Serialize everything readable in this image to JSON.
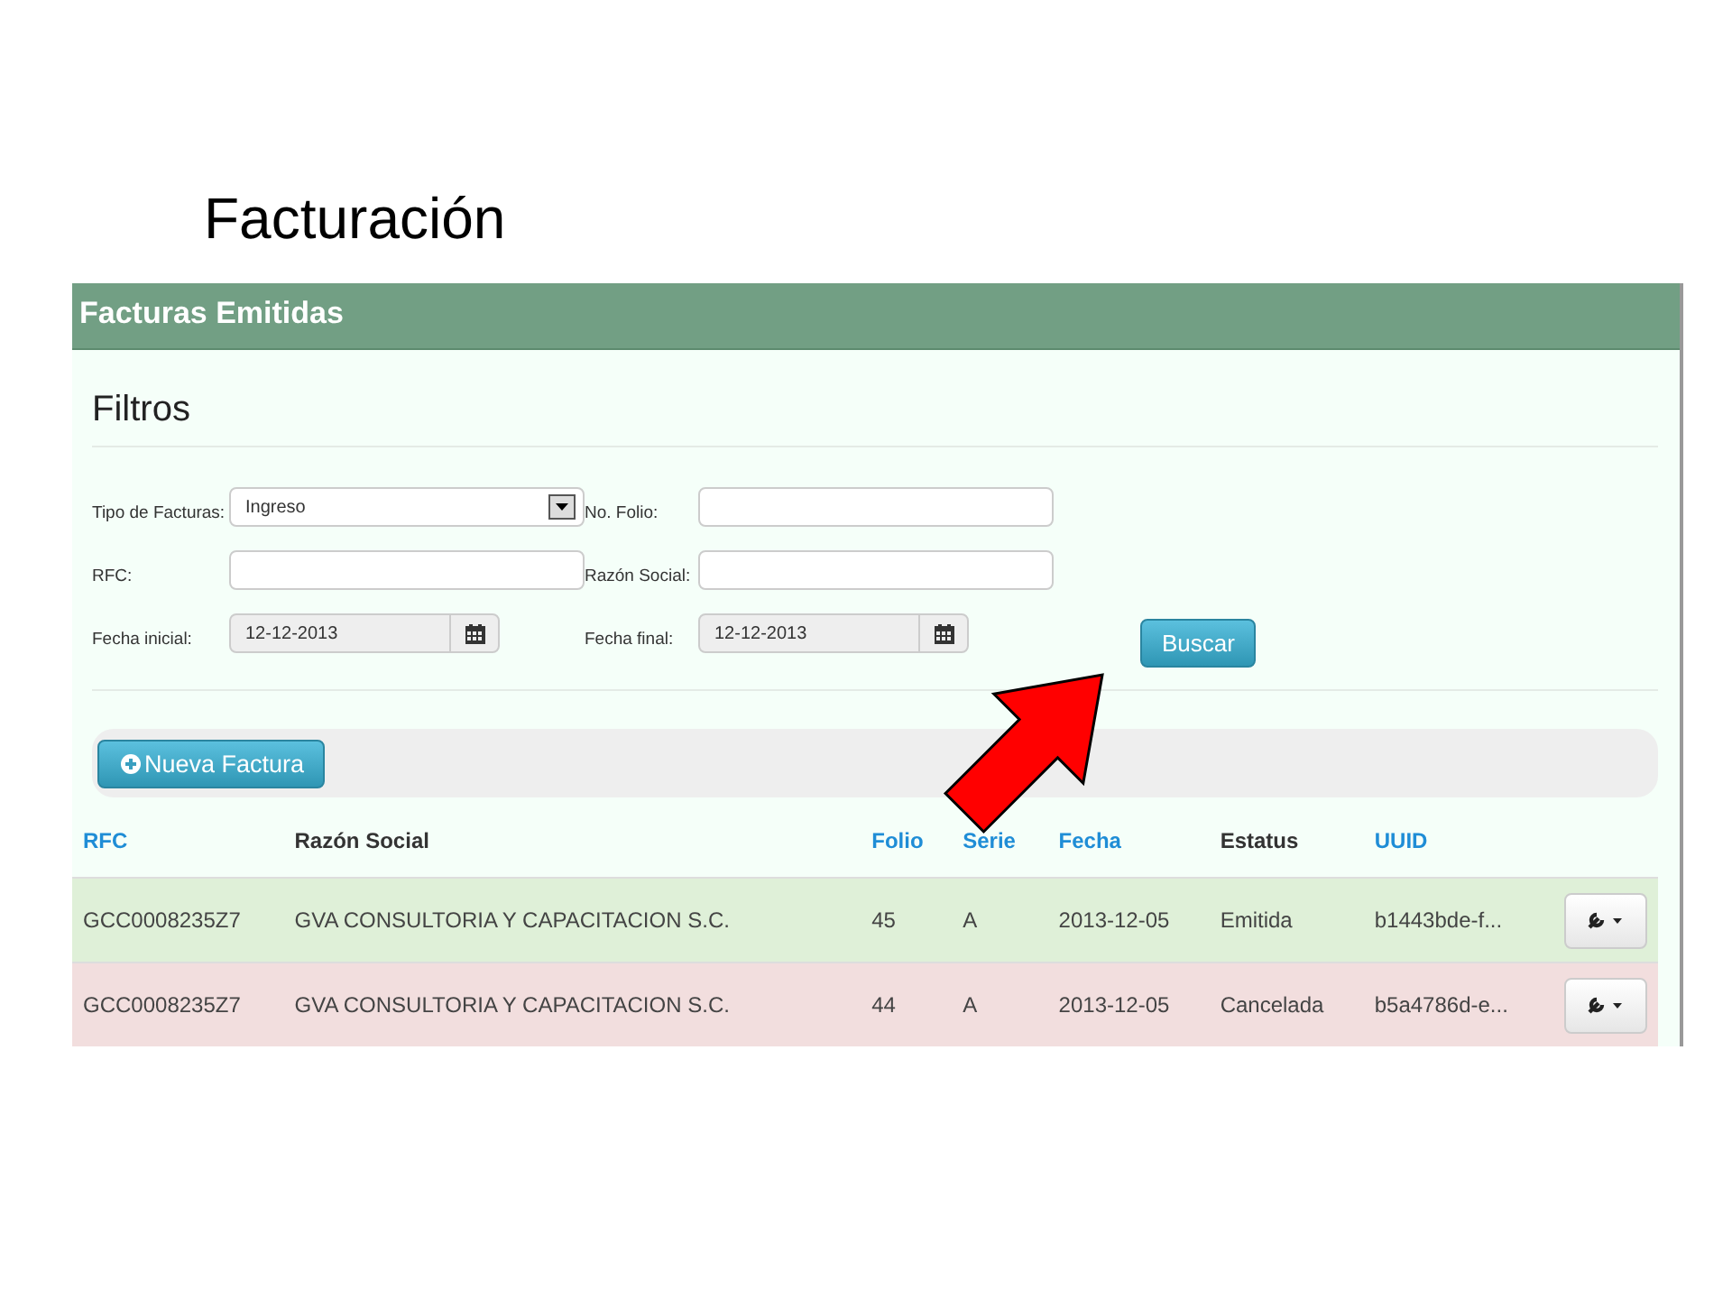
{
  "slide_title": "Facturación",
  "panel": {
    "title": "Facturas Emitidas"
  },
  "filters": {
    "title": "Filtros",
    "fields": [
      {
        "kind": "select",
        "label": "Tipo de Facturas:",
        "value": "Ingreso"
      },
      {
        "kind": "text",
        "label": "No. Folio:"
      },
      {
        "kind": "text",
        "label": "RFC:"
      },
      {
        "kind": "text",
        "label": "Razón Social:"
      },
      {
        "kind": "date",
        "label": "Fecha inicial:",
        "value": "12-12-2013"
      },
      {
        "kind": "date",
        "label": "Fecha final:",
        "value": "12-12-2013"
      }
    ],
    "search_button": "Buscar"
  },
  "new_button": "Nueva Factura",
  "table": {
    "columns": [
      {
        "label": "RFC",
        "sortable": true
      },
      {
        "label": "Razón Social",
        "sortable": false
      },
      {
        "label": "Folio",
        "sortable": true
      },
      {
        "label": "Serie",
        "sortable": true
      },
      {
        "label": "Fecha",
        "sortable": true
      },
      {
        "label": "Estatus",
        "sortable": false
      },
      {
        "label": "UUID",
        "sortable": true
      }
    ],
    "rows": [
      {
        "color": "#dff0d8",
        "cells": [
          "GCC0008235Z7",
          "GVA CONSULTORIA Y CAPACITACION S.C.",
          "45",
          "A",
          "2013-12-05",
          "Emitida",
          "b1443bde-f..."
        ]
      },
      {
        "color": "#f2dede",
        "cells": [
          "GCC0008235Z7",
          "GVA CONSULTORIA Y CAPACITACION S.C.",
          "44",
          "A",
          "2013-12-05",
          "Cancelada",
          "b5a4786d-e..."
        ]
      }
    ]
  }
}
